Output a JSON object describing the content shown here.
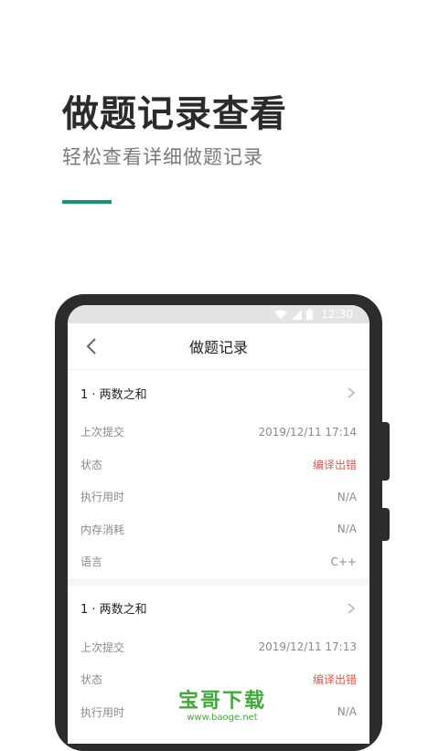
{
  "hero": {
    "title": "做题记录查看",
    "subtitle": "轻松查看详细做题记录",
    "accent_color": "#0f9a6f"
  },
  "status_bar": {
    "time": "12:30",
    "icons": [
      "wifi-icon",
      "signal-icon",
      "battery-icon"
    ]
  },
  "app_bar": {
    "back_icon": "chevron-left-icon",
    "title": "做题记录"
  },
  "records": [
    {
      "problem": "1 · 两数之和",
      "fields": [
        {
          "label": "上次提交",
          "value": "2019/12/11 17:14",
          "status": "normal"
        },
        {
          "label": "状态",
          "value": "编译出错",
          "status": "error"
        },
        {
          "label": "执行用时",
          "value": "N/A",
          "status": "normal"
        },
        {
          "label": "内存消耗",
          "value": "N/A",
          "status": "normal"
        },
        {
          "label": "语言",
          "value": "C++",
          "status": "normal"
        }
      ]
    },
    {
      "problem": "1 · 两数之和",
      "fields": [
        {
          "label": "上次提交",
          "value": "2019/12/11 17:13",
          "status": "normal"
        },
        {
          "label": "状态",
          "value": "编译出错",
          "status": "error"
        },
        {
          "label": "执行用时",
          "value": "N/A",
          "status": "normal"
        }
      ]
    }
  ],
  "watermark": {
    "title": "宝哥下载",
    "url": "www.baoge.net"
  }
}
